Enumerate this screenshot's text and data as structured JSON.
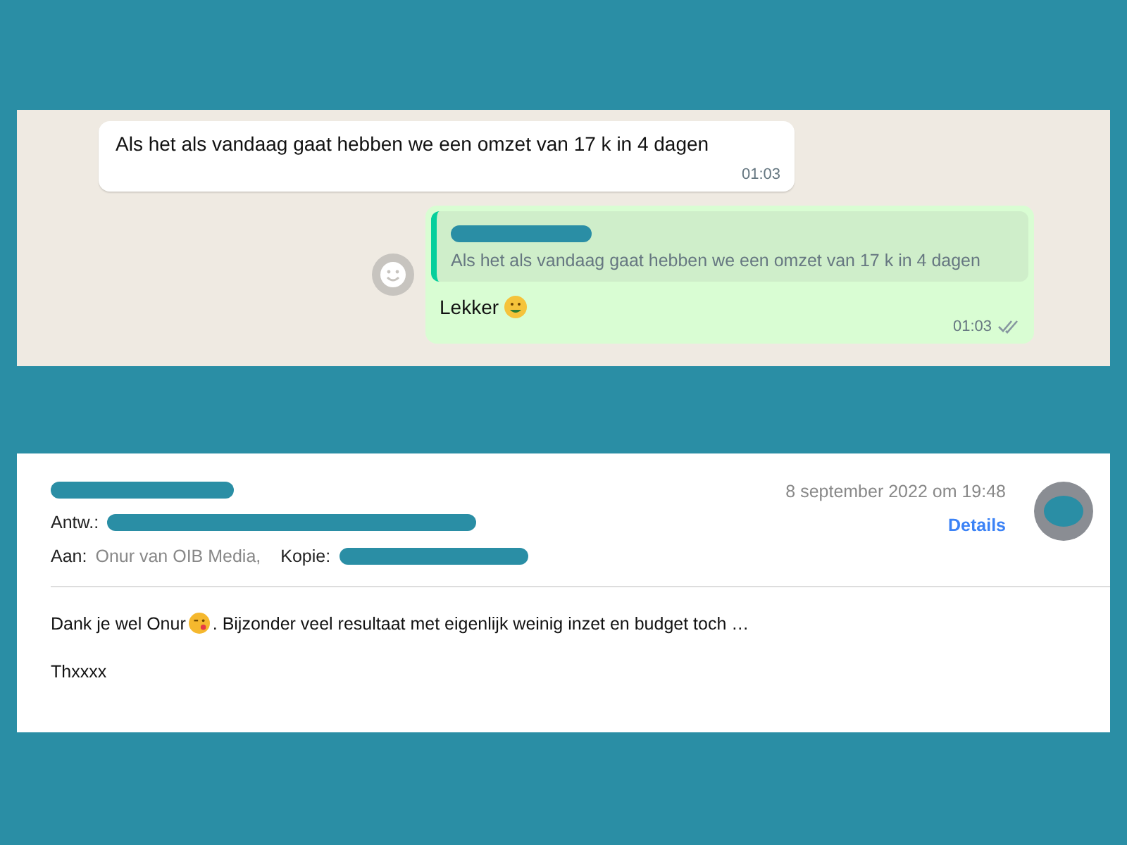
{
  "chat": {
    "incoming": {
      "text": "Als het als vandaag gaat hebben we een omzet van 17 k in 4 dagen",
      "time": "01:03"
    },
    "outgoing": {
      "quote": "Als het als vandaag gaat hebben we een omzet van 17 k in 4 dagen",
      "text": "Lekker",
      "time": "01:03"
    }
  },
  "email": {
    "date": "8 september 2022 om 19:48",
    "details": "Details",
    "reply_label": "Antw.:",
    "to_label": "Aan:",
    "to": "Onur van OIB Media,",
    "cc_label": "Kopie:",
    "body_start": "Dank je wel Onur",
    "body_end": ". Bijzonder veel resultaat met eigenlijk weinig inzet en budget toch …",
    "signoff": "Thxxxx"
  }
}
